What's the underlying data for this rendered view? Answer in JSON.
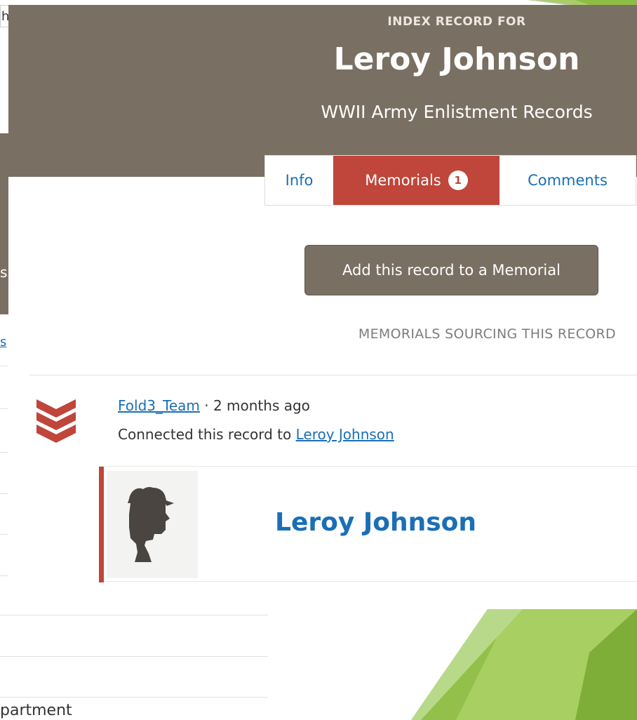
{
  "background_window": {
    "top_fragment": "h",
    "header_fragment": "s",
    "link_fragment": "s",
    "text_fragment": "partment"
  },
  "record": {
    "eyebrow": "INDEX RECORD FOR",
    "name": "Leroy Johnson",
    "collection": "WWII Army Enlistment Records"
  },
  "tabs": [
    {
      "label": "Info"
    },
    {
      "label": "Memorials",
      "badge": "1",
      "active": true
    },
    {
      "label": "Comments"
    }
  ],
  "add_button_label": "Add this record to a Memorial",
  "sourcing_title": "MEMORIALS SOURCING THIS RECORD",
  "activity": {
    "user": "Fold3_Team",
    "separator": " · ",
    "time": "2 months ago",
    "action_text": "Connected this record to ",
    "target": "Leroy Johnson"
  },
  "memorial_card": {
    "name": "Leroy Johnson"
  },
  "colors": {
    "header": "#7a6f63",
    "accent_red": "#c0453a",
    "link_blue": "#1a6fb6",
    "slide_green": "#8fbc45"
  },
  "icons": {
    "activity": "fold3-chevrons-icon",
    "memorial_photo": "soldier-silhouette-icon"
  }
}
